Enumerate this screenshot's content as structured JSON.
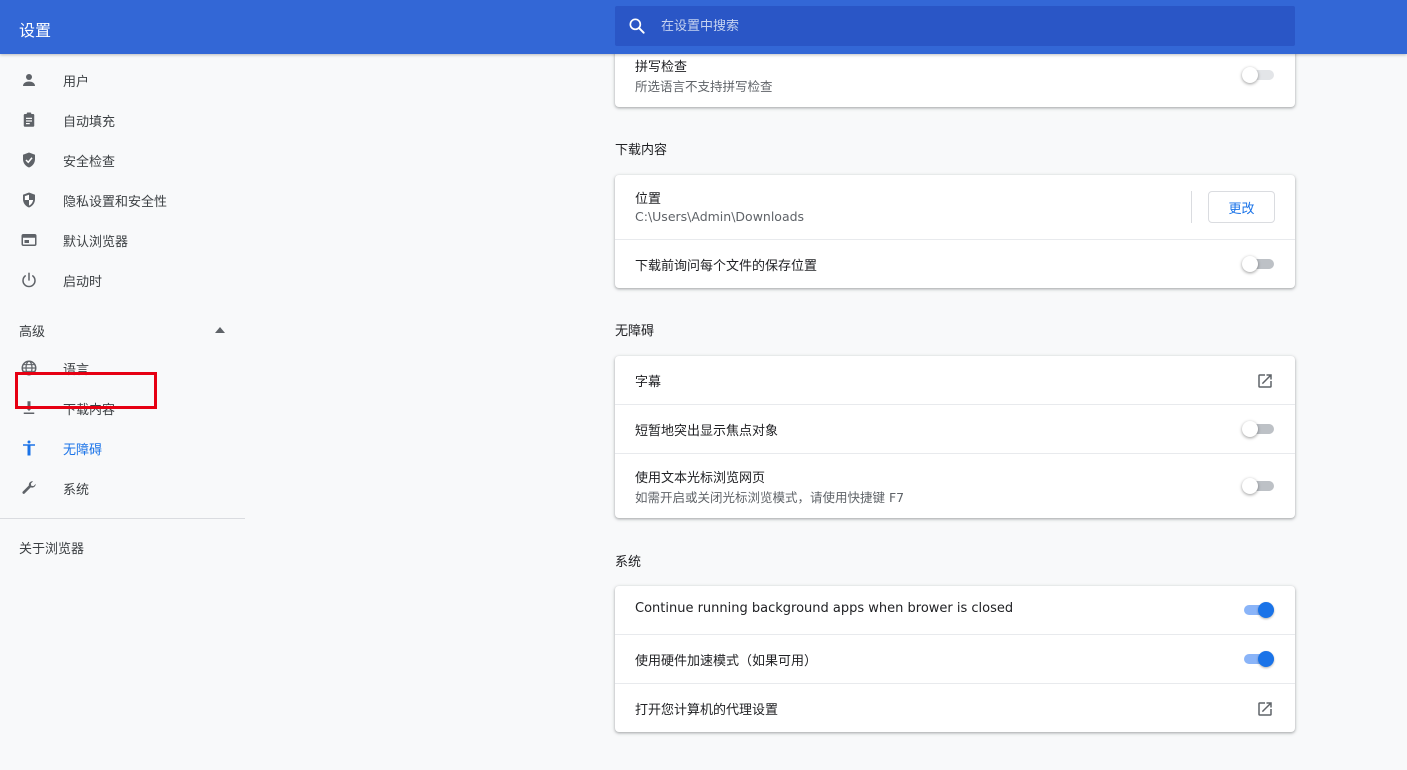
{
  "header": {
    "title": "设置",
    "search_placeholder": "在设置中搜索"
  },
  "sidebar": {
    "items": [
      {
        "label": "用户",
        "icon": "person-icon"
      },
      {
        "label": "自动填充",
        "icon": "clipboard-icon"
      },
      {
        "label": "安全检查",
        "icon": "shield-check-icon"
      },
      {
        "label": "隐私设置和安全性",
        "icon": "shield-half-icon"
      },
      {
        "label": "默认浏览器",
        "icon": "browser-window-icon"
      },
      {
        "label": "启动时",
        "icon": "power-icon"
      }
    ],
    "advanced_label": "高级",
    "advanced_items": [
      {
        "label": "语言",
        "icon": "globe-icon"
      },
      {
        "label": "下载内容",
        "icon": "download-icon"
      },
      {
        "label": "无障碍",
        "icon": "accessibility-icon",
        "active": true
      },
      {
        "label": "系统",
        "icon": "wrench-icon"
      }
    ],
    "about_label": "关于浏览器"
  },
  "main": {
    "spellcheck": {
      "title": "拼写检查",
      "subtitle": "所选语言不支持拼写检查",
      "enabled": false
    },
    "downloads": {
      "section_title": "下载内容",
      "location_title": "位置",
      "location_path": "C:\\Users\\Admin\\Downloads",
      "change_button": "更改",
      "ask_title": "下载前询问每个文件的保存位置",
      "ask_enabled": false
    },
    "accessibility": {
      "section_title": "无障碍",
      "captions_title": "字幕",
      "focus_title": "短暂地突出显示焦点对象",
      "focus_enabled": false,
      "caret_title": "使用文本光标浏览网页",
      "caret_subtitle": "如需开启或关闭光标浏览模式，请使用快捷键 F7",
      "caret_enabled": false
    },
    "system": {
      "section_title": "系统",
      "background_title": "Continue running background apps when brower is closed",
      "background_enabled": true,
      "hw_title": "使用硬件加速模式（如果可用）",
      "hw_enabled": true,
      "proxy_title": "打开您计算机的代理设置"
    }
  },
  "colors": {
    "header_bg": "#3367d6",
    "search_bg": "#2a56c6",
    "accent": "#1a73e8",
    "highlight_box": "#e60012"
  }
}
